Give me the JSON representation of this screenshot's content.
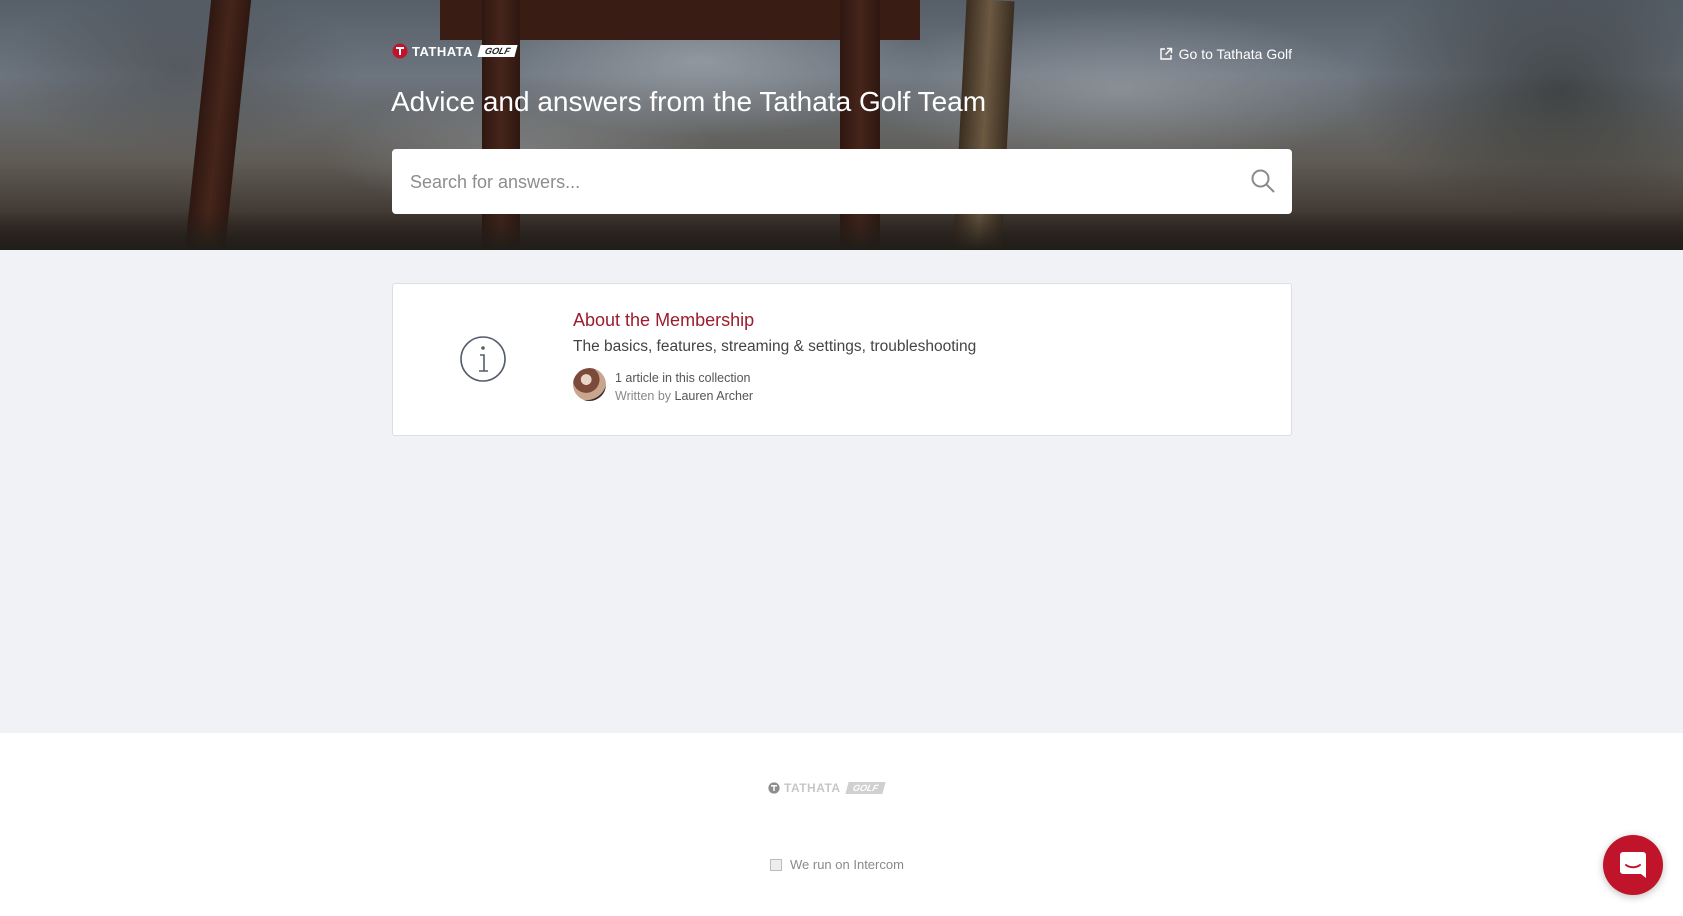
{
  "header": {
    "brand_name": "TATHATA",
    "brand_suffix": "GOLF",
    "goto_link": "Go to Tathata Golf",
    "headline": "Advice and answers from the Tathata Golf Team"
  },
  "search": {
    "placeholder": "Search for answers...",
    "value": ""
  },
  "collections": [
    {
      "icon": "info-icon",
      "title": "About the Membership",
      "description": "The basics, features, streaming & settings, troubleshooting",
      "article_count": "1 article in this collection",
      "written_by_label": "Written by",
      "author": "Lauren Archer"
    }
  ],
  "footer": {
    "brand_name": "TATHATA",
    "brand_suffix": "GOLF",
    "intercom_text": "We run on Intercom"
  },
  "colors": {
    "accent": "#9b1c2e",
    "launcher": "#c0142a",
    "page_background": "#f1f2f5"
  }
}
